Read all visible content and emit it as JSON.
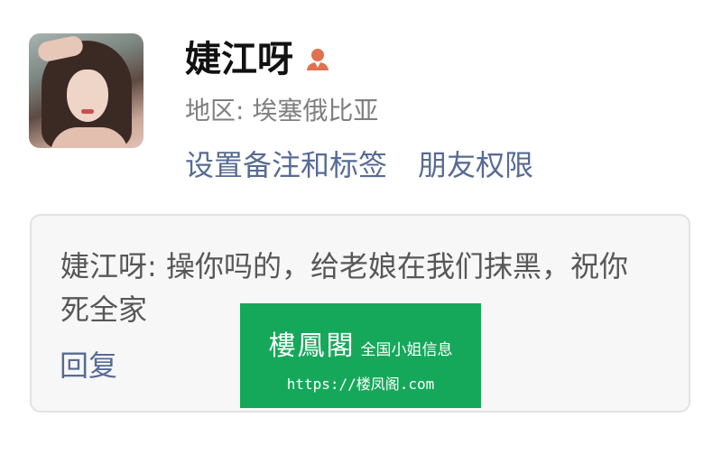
{
  "profile": {
    "name": "婕江呀",
    "gender_icon": "female-person-icon",
    "gender_color": "#e0704f",
    "region": "地区: 埃塞俄比亚"
  },
  "actions": {
    "remark_label": "设置备注和标签",
    "permission_label": "朋友权限"
  },
  "comment": {
    "text": "婕江呀: 操你吗的，给老娘在我们抹黑，祝你死全家",
    "reply_label": "回复"
  },
  "watermark": {
    "logo": "樓鳳閣",
    "subtitle": "全国小姐信息",
    "url": "https://楼凤阁.com",
    "color": "#16a85a"
  },
  "colors": {
    "link": "#576b95",
    "card_bg": "#f7f7f7"
  }
}
